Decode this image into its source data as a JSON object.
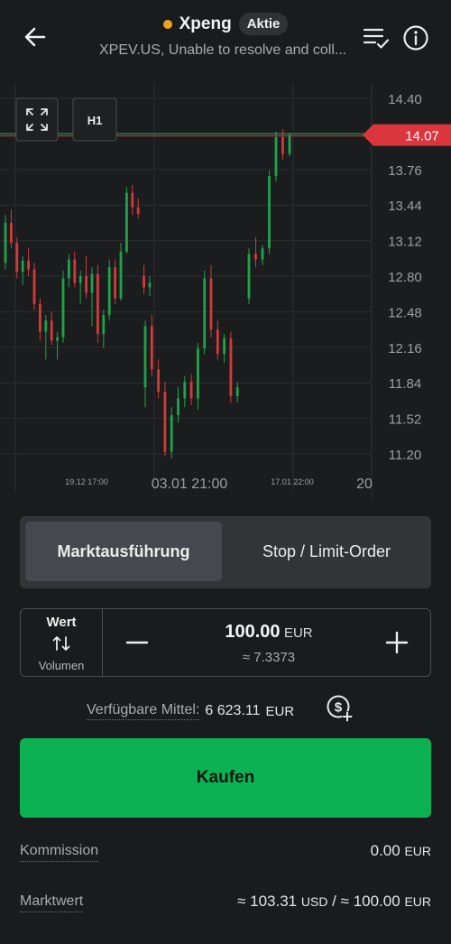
{
  "header": {
    "title": "Xpeng",
    "badge": "Aktie",
    "subtitle": "XPEV.US, Unable to resolve and coll...",
    "status_color": "#f0a31c"
  },
  "chart": {
    "timeframe_label": "H1",
    "current_price": "14.07",
    "y_ticks": [
      "14.40",
      "13.76",
      "13.44",
      "13.12",
      "12.80",
      "12.48",
      "12.16",
      "11.84",
      "11.52",
      "11.20"
    ],
    "x_labels": [
      "19.12 17:00",
      "03.01 21:00",
      "17.01 22:00",
      "20"
    ],
    "up_color": "#1fa34a",
    "down_color": "#d23a3a"
  },
  "chart_data": {
    "type": "candlestick",
    "ylim": [
      11.0,
      14.55
    ],
    "current_price": 14.07,
    "series": [
      {
        "values": [
          [
            12.92,
            13.35,
            12.86,
            13.28
          ],
          [
            13.28,
            13.4,
            13.05,
            13.1
          ],
          [
            13.1,
            13.15,
            12.78,
            12.84
          ],
          [
            12.84,
            12.98,
            12.72,
            12.94
          ],
          [
            12.94,
            13.05,
            12.8,
            12.86
          ],
          [
            12.86,
            12.92,
            12.5,
            12.55
          ],
          [
            12.55,
            12.6,
            12.22,
            12.3
          ],
          [
            12.3,
            12.45,
            12.05,
            12.4
          ],
          [
            12.4,
            12.48,
            12.18,
            12.22
          ],
          [
            12.22,
            12.3,
            12.05,
            12.25
          ],
          [
            12.25,
            12.85,
            12.2,
            12.78
          ],
          [
            12.78,
            13.0,
            12.7,
            12.95
          ],
          [
            12.95,
            13.02,
            12.7,
            12.74
          ],
          [
            12.74,
            12.85,
            12.55,
            12.8
          ],
          [
            12.8,
            12.98,
            12.6,
            12.65
          ],
          [
            12.65,
            12.88,
            12.35,
            12.82
          ],
          [
            12.82,
            12.9,
            12.2,
            12.28
          ],
          [
            12.28,
            12.5,
            12.15,
            12.45
          ],
          [
            12.45,
            12.95,
            12.4,
            12.88
          ],
          [
            12.88,
            12.95,
            12.55,
            12.6
          ],
          [
            12.6,
            13.1,
            12.58,
            13.02
          ],
          [
            13.02,
            13.6,
            13.0,
            13.55
          ],
          [
            13.55,
            13.62,
            13.35,
            13.42
          ],
          [
            13.42,
            13.5,
            13.32,
            13.36
          ],
          [
            12.8,
            12.9,
            12.64,
            12.7
          ],
          [
            12.7,
            12.8,
            12.62,
            12.74
          ],
          [
            11.8,
            12.4,
            11.62,
            12.35
          ],
          [
            12.35,
            12.45,
            11.9,
            11.96
          ],
          [
            11.96,
            12.05,
            11.7,
            11.76
          ],
          [
            11.76,
            11.85,
            11.18,
            11.22
          ],
          [
            11.22,
            11.62,
            11.16,
            11.55
          ],
          [
            11.55,
            11.8,
            11.48,
            11.7
          ],
          [
            11.7,
            11.9,
            11.62,
            11.85
          ],
          [
            11.85,
            11.92,
            11.64,
            11.7
          ],
          [
            11.7,
            12.2,
            11.6,
            12.15
          ],
          [
            12.15,
            12.85,
            12.1,
            12.78
          ],
          [
            12.78,
            12.9,
            12.25,
            12.32
          ],
          [
            12.32,
            12.4,
            12.05,
            12.1
          ],
          [
            12.1,
            12.28,
            12.02,
            12.24
          ],
          [
            12.24,
            12.3,
            11.66,
            11.72
          ],
          [
            11.72,
            11.85,
            11.66,
            11.8
          ],
          [
            12.6,
            13.05,
            12.55,
            13.0
          ],
          [
            13.0,
            13.15,
            12.88,
            12.95
          ],
          [
            12.95,
            13.08,
            12.9,
            13.05
          ],
          [
            13.05,
            13.75,
            13.0,
            13.7
          ],
          [
            13.7,
            14.1,
            13.65,
            14.05
          ],
          [
            14.05,
            14.12,
            13.85,
            13.9
          ],
          [
            13.9,
            14.09,
            13.88,
            14.07
          ]
        ]
      }
    ]
  },
  "order_type": {
    "market_label": "Marktausführung",
    "limit_label": "Stop / Limit-Order"
  },
  "amount": {
    "mode_title": "Wert",
    "mode_alt": "Volumen",
    "value": "100.00",
    "currency": "EUR",
    "equivalent": "≈ 7.3373"
  },
  "funds": {
    "label": "Verfügbare Mittel:",
    "value": "6 623.11",
    "currency": "EUR"
  },
  "buy_label": "Kaufen",
  "summary": {
    "commission_label": "Kommission",
    "commission_value": "0.00",
    "commission_currency": "EUR",
    "market_value_label": "Marktwert",
    "market_value_usd": "≈ 103.31",
    "market_value_usd_cur": "USD",
    "market_value_sep": "/",
    "market_value_eur": "≈ 100.00",
    "market_value_eur_cur": "EUR"
  }
}
